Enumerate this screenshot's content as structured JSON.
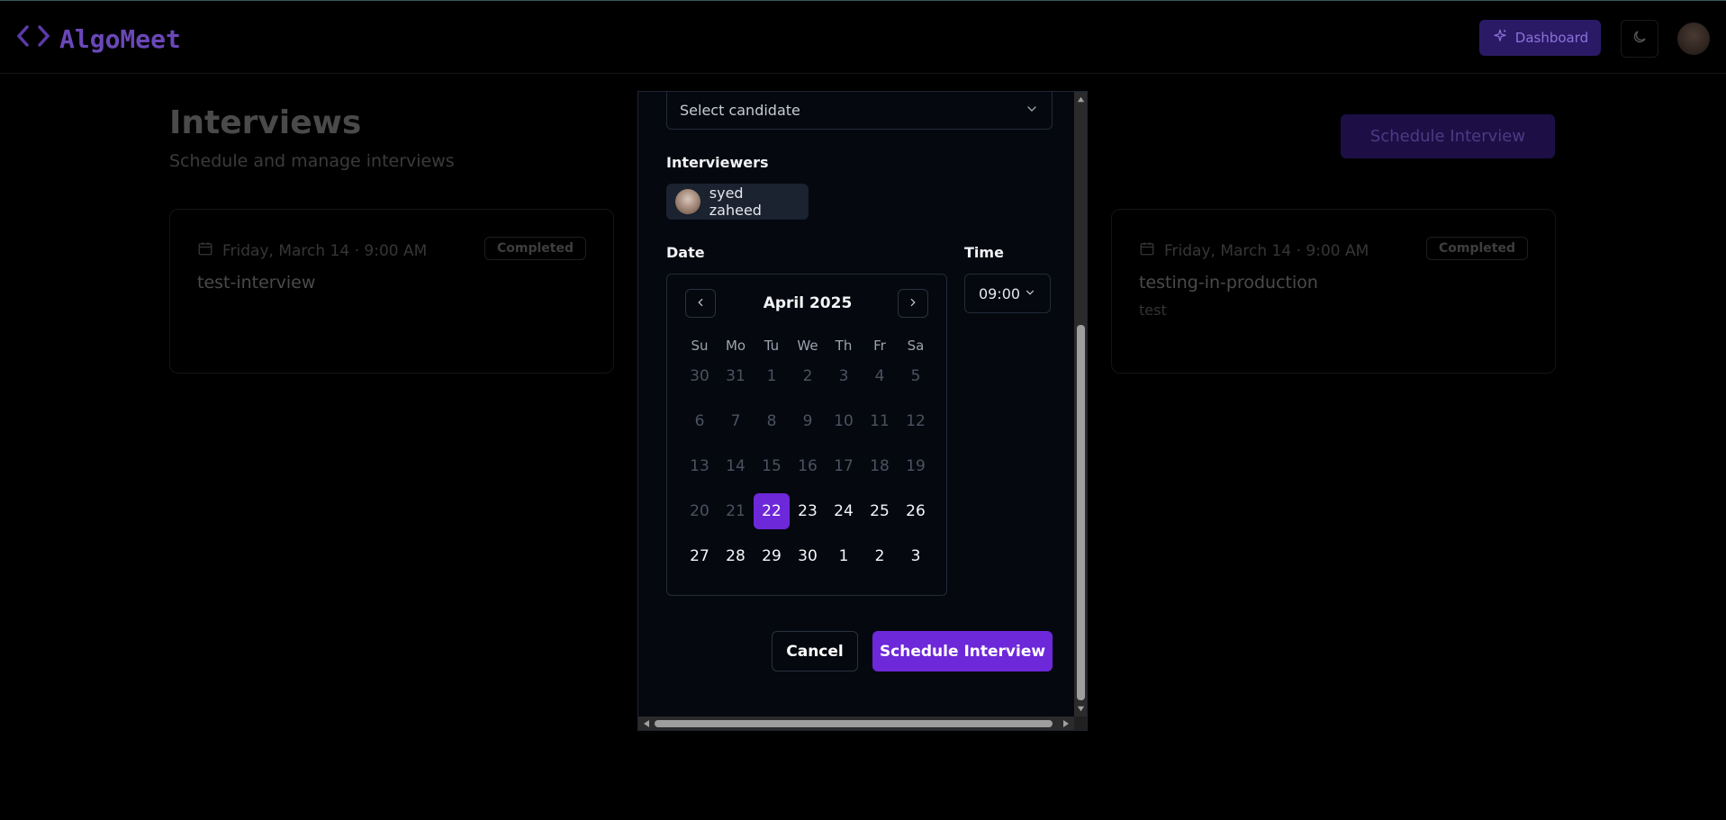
{
  "app": {
    "brand_icon": "<>",
    "brand_name": "AlgoMeet",
    "dashboard_label": "Dashboard"
  },
  "page": {
    "title": "Interviews",
    "subtitle": "Schedule and manage interviews",
    "schedule_button": "Schedule Interview"
  },
  "cards": [
    {
      "date": "Friday, March 14 · 9:00 AM",
      "status": "Completed",
      "title": "test-interview",
      "description": ""
    },
    {
      "date": "Friday, March 14 · 9:00 AM",
      "status": "Completed",
      "title": "testing-in-production",
      "description": "test"
    }
  ],
  "modal": {
    "candidate_placeholder": "Select candidate",
    "interviewers_label": "Interviewers",
    "interviewer_name": "syed zaheed",
    "date_label": "Date",
    "time_label": "Time",
    "time_value": "09:00",
    "calendar": {
      "month": "April 2025",
      "weekdays": [
        "Su",
        "Mo",
        "Tu",
        "We",
        "Th",
        "Fr",
        "Sa"
      ],
      "days": [
        {
          "d": "30",
          "s": "disabled"
        },
        {
          "d": "31",
          "s": "disabled"
        },
        {
          "d": "1",
          "s": "disabled"
        },
        {
          "d": "2",
          "s": "disabled"
        },
        {
          "d": "3",
          "s": "disabled"
        },
        {
          "d": "4",
          "s": "disabled"
        },
        {
          "d": "5",
          "s": "disabled"
        },
        {
          "d": "6",
          "s": "disabled"
        },
        {
          "d": "7",
          "s": "disabled"
        },
        {
          "d": "8",
          "s": "disabled"
        },
        {
          "d": "9",
          "s": "disabled"
        },
        {
          "d": "10",
          "s": "disabled"
        },
        {
          "d": "11",
          "s": "disabled"
        },
        {
          "d": "12",
          "s": "disabled"
        },
        {
          "d": "13",
          "s": "disabled"
        },
        {
          "d": "14",
          "s": "disabled"
        },
        {
          "d": "15",
          "s": "disabled"
        },
        {
          "d": "16",
          "s": "disabled"
        },
        {
          "d": "17",
          "s": "disabled"
        },
        {
          "d": "18",
          "s": "disabled"
        },
        {
          "d": "19",
          "s": "disabled"
        },
        {
          "d": "20",
          "s": "disabled"
        },
        {
          "d": "21",
          "s": "disabled"
        },
        {
          "d": "22",
          "s": "selected"
        },
        {
          "d": "23",
          "s": "active"
        },
        {
          "d": "24",
          "s": "active"
        },
        {
          "d": "25",
          "s": "active"
        },
        {
          "d": "26",
          "s": "active"
        },
        {
          "d": "27",
          "s": "active"
        },
        {
          "d": "28",
          "s": "active"
        },
        {
          "d": "29",
          "s": "active"
        },
        {
          "d": "30",
          "s": "active"
        },
        {
          "d": "1",
          "s": "active"
        },
        {
          "d": "2",
          "s": "active"
        },
        {
          "d": "3",
          "s": "active"
        }
      ]
    },
    "cancel_label": "Cancel",
    "submit_label": "Schedule Interview"
  },
  "colors": {
    "accent": "#6d28d9",
    "background": "#000000",
    "modal_bg": "#05080f"
  },
  "icons": [
    "code-brackets-icon",
    "sparkles-icon",
    "moon-icon",
    "calendar-icon",
    "chevron-down-icon",
    "chevron-left-icon",
    "chevron-right-icon"
  ]
}
